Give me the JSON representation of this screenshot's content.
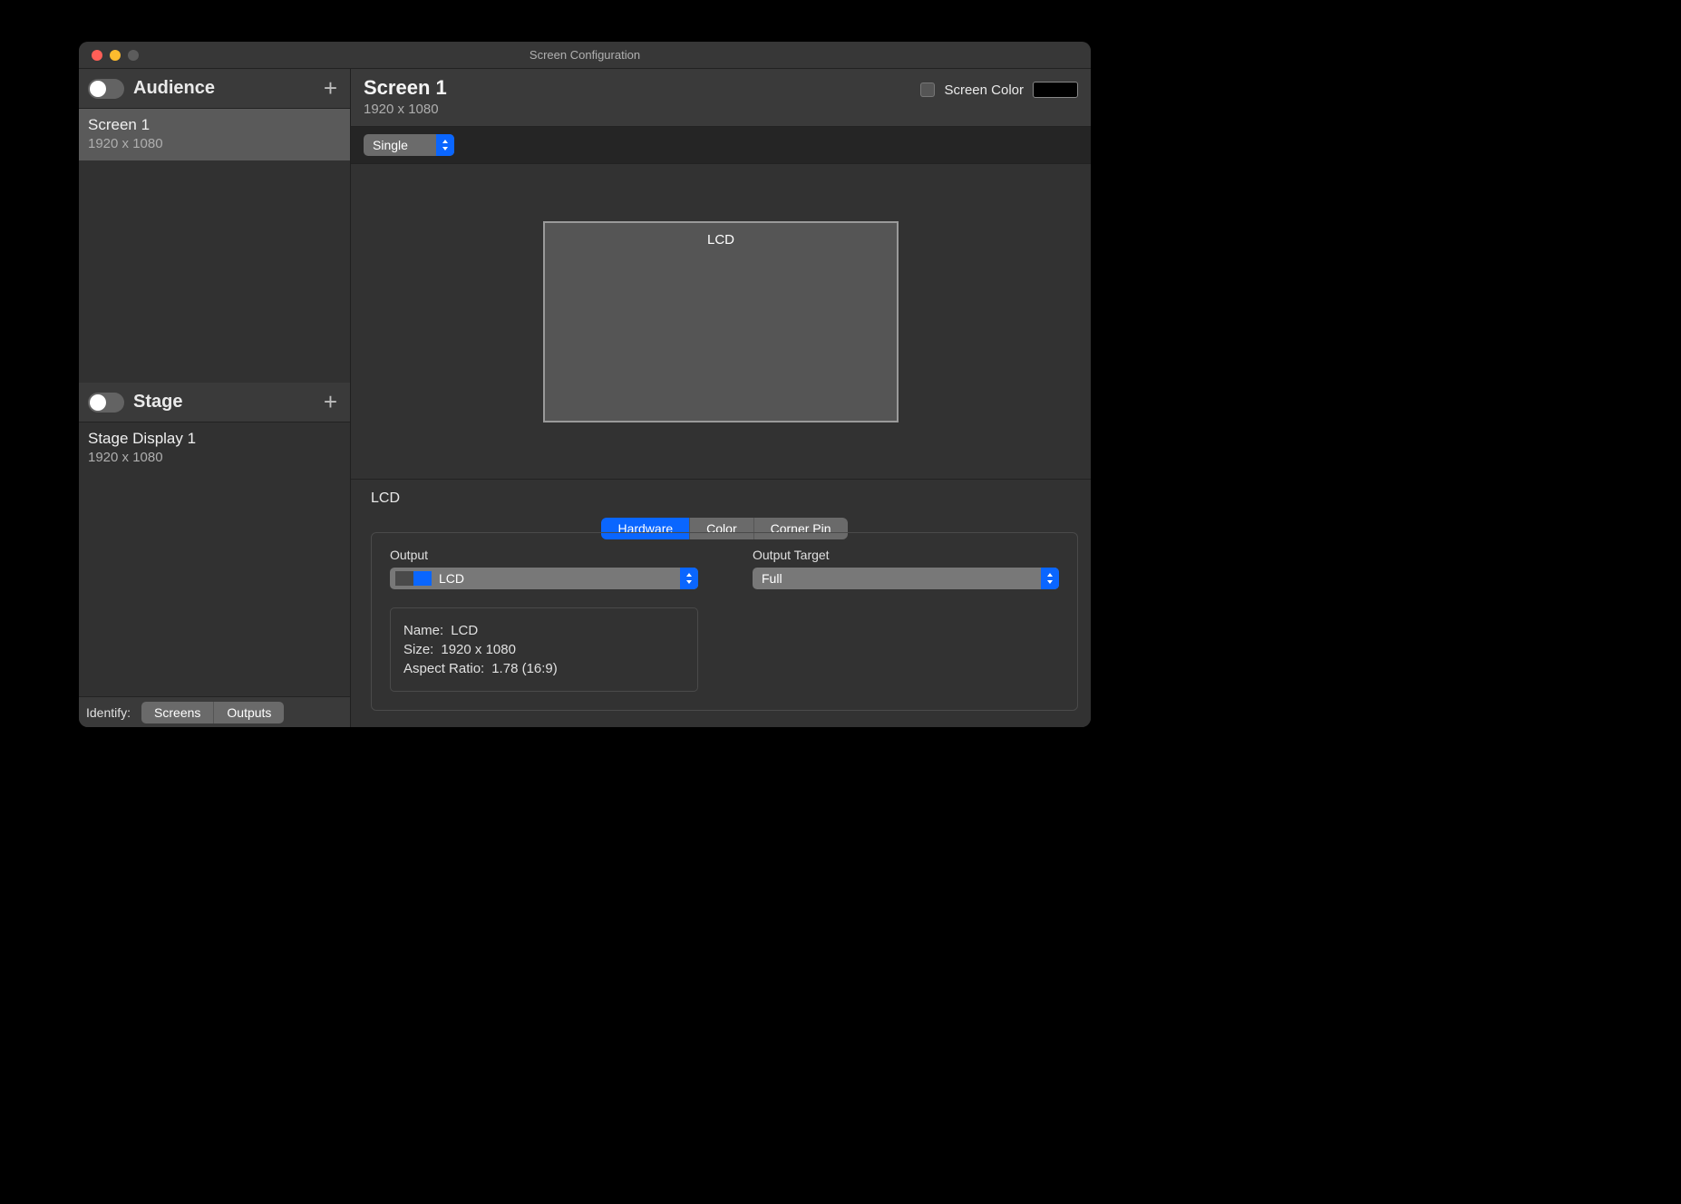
{
  "window_title": "Screen Configuration",
  "sidebar": {
    "sections": [
      {
        "title": "Audience",
        "items": [
          {
            "name": "Screen 1",
            "resolution": "1920 x 1080",
            "selected": true
          }
        ]
      },
      {
        "title": "Stage",
        "items": [
          {
            "name": "Stage Display 1",
            "resolution": "1920 x 1080",
            "selected": false
          }
        ]
      }
    ],
    "identify_label": "Identify:",
    "identify_buttons": [
      "Screens",
      "Outputs"
    ]
  },
  "main": {
    "title": "Screen 1",
    "resolution": "1920 x 1080",
    "screen_color_label": "Screen Color",
    "screen_color_value": "#000000",
    "mode_select": "Single",
    "preview_label": "LCD"
  },
  "detail": {
    "title": "LCD",
    "tabs": [
      "Hardware",
      "Color",
      "Corner Pin"
    ],
    "active_tab": "Hardware",
    "output_label": "Output",
    "output_value": "LCD",
    "target_label": "Output Target",
    "target_value": "Full",
    "info": {
      "name_label": "Name:",
      "name_value": "LCD",
      "size_label": "Size:",
      "size_value": "1920 x 1080",
      "aspect_label": "Aspect Ratio:",
      "aspect_value": "1.78 (16:9)"
    }
  }
}
